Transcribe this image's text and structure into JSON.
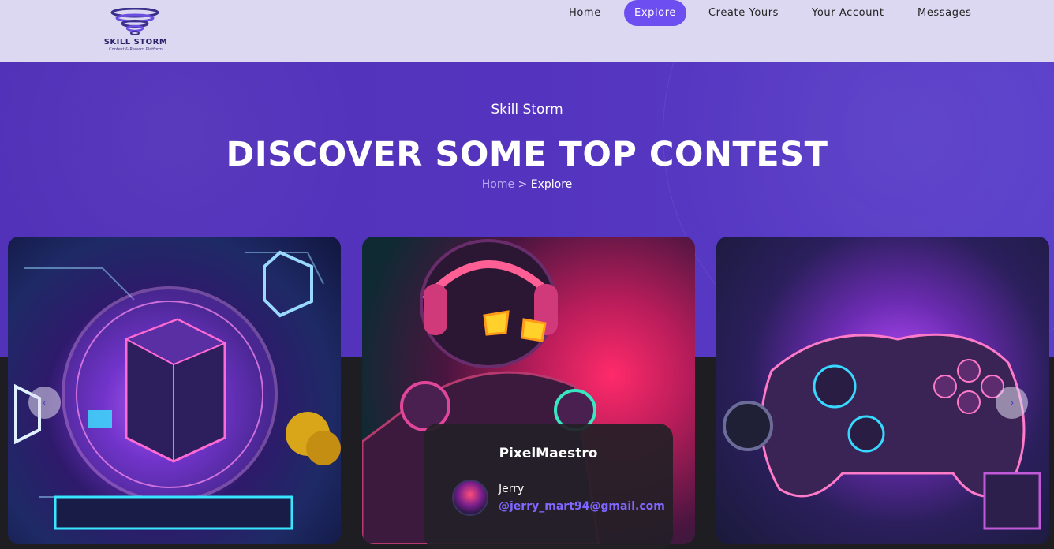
{
  "nav": {
    "logo": {
      "brand": "SKILL STORM",
      "tagline": "Contest & Reward Platform"
    },
    "items": [
      {
        "label": "Home"
      },
      {
        "label": "Explore",
        "active": true
      },
      {
        "label": "Create Yours"
      },
      {
        "label": "Your Account"
      },
      {
        "label": "Messages"
      }
    ]
  },
  "hero": {
    "subtitle": "Skill Storm",
    "title": "DISCOVER SOME TOP CONTEST",
    "breadcrumb": {
      "home": "Home",
      "separator": " > ",
      "current": "Explore"
    }
  },
  "carousel": {
    "prev_icon": "‹",
    "next_icon": "›",
    "profile": {
      "title": "PixelMaestro",
      "user_name": "Jerry",
      "user_email": "@jerry_mart94@gmail.com"
    }
  },
  "colors": {
    "accent": "#6d4ef0",
    "hero_bg": "#5434be",
    "nav_bg": "#dcd8f2",
    "email": "#7f67ff"
  }
}
